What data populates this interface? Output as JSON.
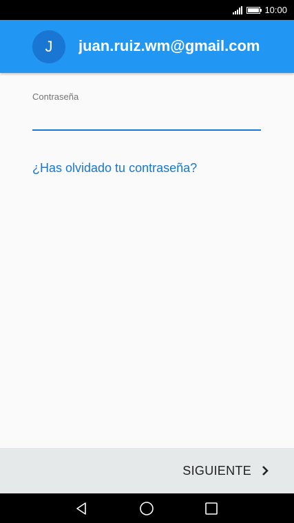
{
  "status_bar": {
    "time": "10:00"
  },
  "header": {
    "avatar_initial": "J",
    "email": "juan.ruiz.wm@gmail.com"
  },
  "form": {
    "password_label": "Contraseña",
    "password_value": "",
    "forgot_link": "¿Has olvidado tu contraseña?"
  },
  "footer": {
    "next_label": "SIGUIENTE"
  },
  "colors": {
    "header": "#2196f3",
    "avatar": "#1976d2",
    "accent": "#1976d2",
    "footer": "#e6e9ea"
  },
  "icons": {
    "signal": "signal-icon",
    "battery": "battery-icon",
    "next": "chevron-right-icon",
    "back": "back-triangle-icon",
    "home": "home-circle-icon",
    "recent": "recent-square-icon"
  }
}
